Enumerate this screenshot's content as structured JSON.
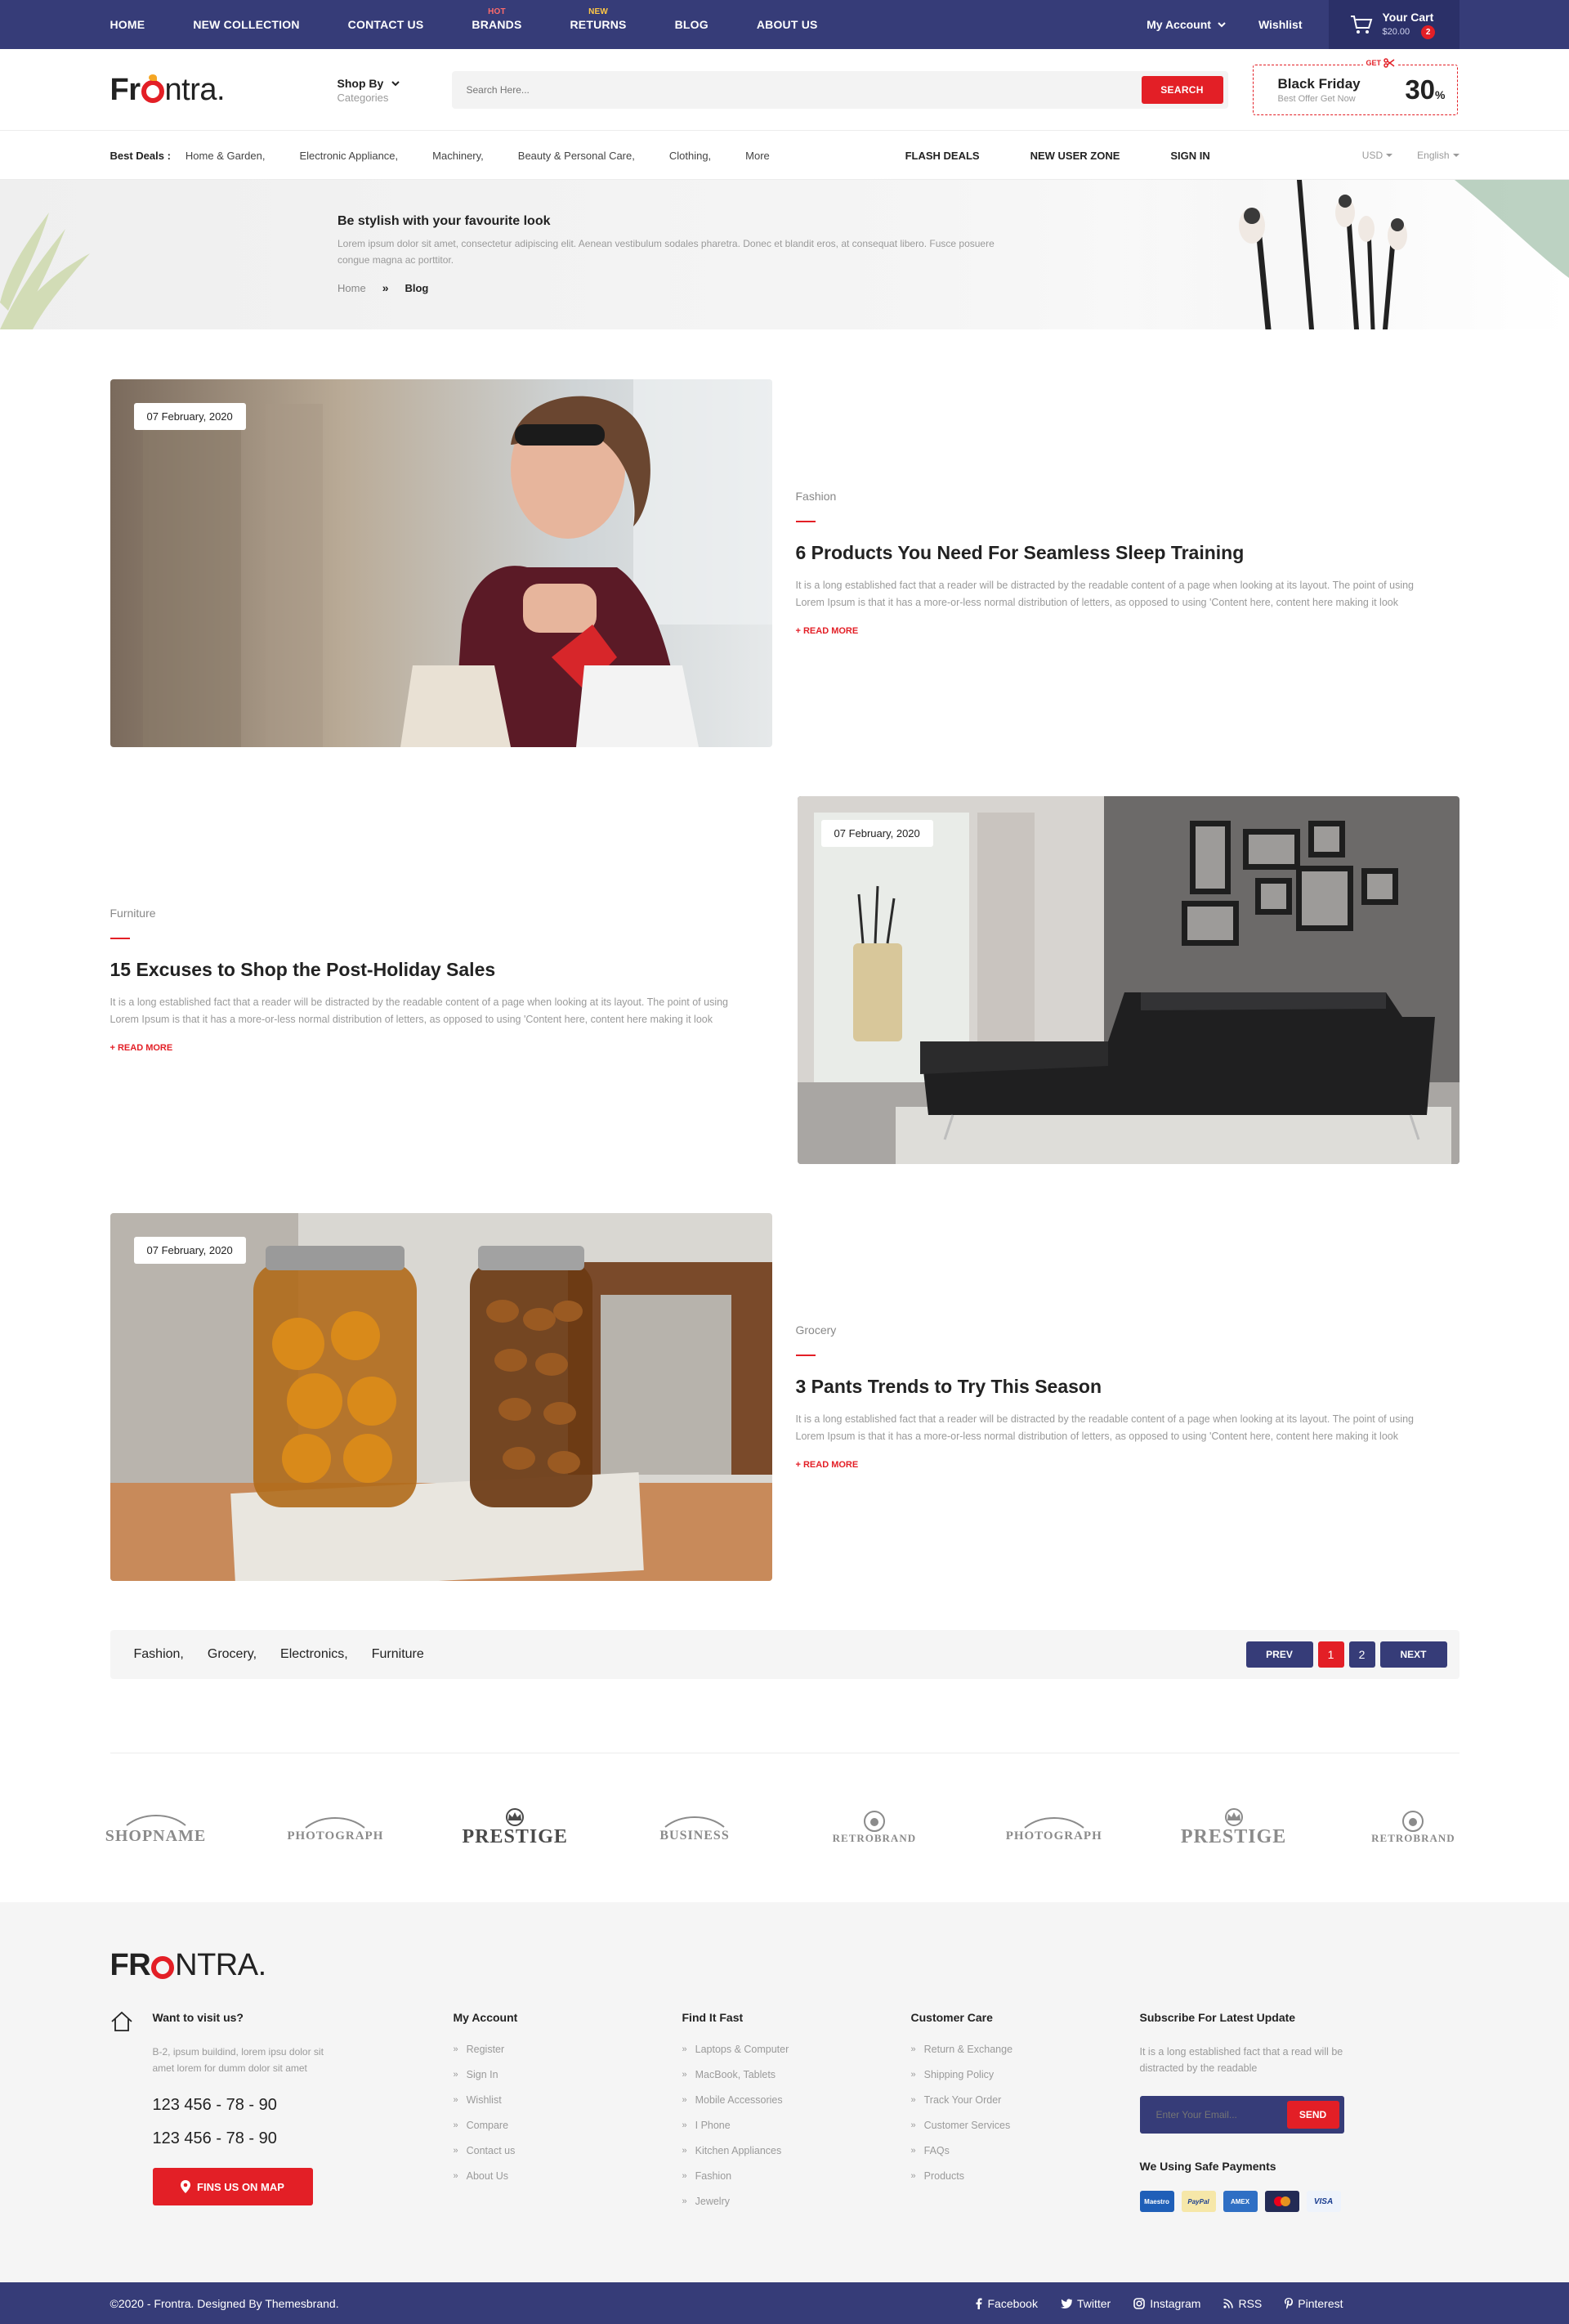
{
  "topnav": {
    "items": [
      {
        "label": "HOME",
        "badge": ""
      },
      {
        "label": "NEW COLLECTION",
        "badge": ""
      },
      {
        "label": "CONTACT US",
        "badge": ""
      },
      {
        "label": "BRANDS",
        "badge": "HOT"
      },
      {
        "label": "RETURNS",
        "badge": "NEW"
      },
      {
        "label": "BLOG",
        "badge": ""
      },
      {
        "label": "ABOUT US",
        "badge": ""
      }
    ],
    "account": "My Account",
    "wishlist": "Wishlist",
    "cart": {
      "title": "Your Cart",
      "amount": "$20.00",
      "count": "2"
    }
  },
  "header": {
    "logo": {
      "pre": "Fr",
      "post": "ntra."
    },
    "shopby": {
      "title": "Shop By",
      "sub": "Categories"
    },
    "search": {
      "placeholder": "Search Here...",
      "button": "SEARCH"
    },
    "promo": {
      "get": "GET",
      "title": "Black Friday",
      "sub": "Best Offer Get Now",
      "value": "30",
      "unit": "%"
    }
  },
  "deals": {
    "label": "Best Deals :",
    "links": [
      "Home & Garden,",
      "Electronic Appliance,",
      "Machinery,",
      "Beauty & Personal Care,",
      "Clothing,",
      "More"
    ],
    "strong": [
      "FLASH DEALS",
      "NEW USER ZONE",
      "SIGN IN"
    ],
    "currency": "USD",
    "language": "English"
  },
  "hero": {
    "title": "Be stylish with your favourite look",
    "text": "Lorem ipsum dolor sit amet, consectetur adipiscing elit. Aenean vestibulum sodales pharetra. Donec et blandit eros, at consequat libero. Fusce posuere congue magna ac porttitor.",
    "breadcrumb": {
      "home": "Home",
      "sep": "»",
      "current": "Blog"
    }
  },
  "posts": [
    {
      "date": "07 February, 2020",
      "category": "Fashion",
      "title": "6 Products You Need For Seamless Sleep Training",
      "text": "It is a long established fact that a reader will be distracted by the readable content of a page when looking at its layout. The point of using Lorem Ipsum is that it has a more-or-less normal distribution of letters, as opposed to using 'Content here, content here making it look",
      "more": "+ READ MORE"
    },
    {
      "date": "07 February, 2020",
      "category": "Furniture",
      "title": "15 Excuses to Shop the Post-Holiday Sales",
      "text": "It is a long established fact that a reader will be distracted by the readable content of a page when looking at its layout. The point of using Lorem Ipsum is that it has a more-or-less normal distribution of letters, as opposed to using 'Content here, content here making it look",
      "more": "+ READ MORE"
    },
    {
      "date": "07 February, 2020",
      "category": "Grocery",
      "title": "3 Pants Trends to Try This Season",
      "text": "It is a long established fact that a reader will be distracted by the readable content of a page when looking at its layout. The point of using Lorem Ipsum is that it has a more-or-less normal distribution of letters, as opposed to using 'Content here, content here making it look",
      "more": "+ READ MORE"
    }
  ],
  "tags": [
    "Fashion,",
    "Grocery,",
    "Electronics,",
    "Furniture"
  ],
  "pager": {
    "prev": "PREV",
    "pages": [
      "1",
      "2"
    ],
    "next": "NEXT"
  },
  "brands": [
    "SHOPNAME",
    "PHOTOGRAPH",
    "PRESTIGE",
    "BUSINESS",
    "RETROBRAND",
    "PHOTOGRAPH",
    "PRESTIGE",
    "RETROBRAND"
  ],
  "footer": {
    "logo": {
      "pre": "FR",
      "post": "NTRA."
    },
    "visit": {
      "title": "Want to visit us?",
      "address": "B-2, ipsum buildind, lorem ipsu dolor sit amet lorem for dumm dolor sit amet",
      "phone1": "123 456 - 78 - 90",
      "phone2": "123 456 - 78 - 90",
      "map_button": "FINS US ON MAP"
    },
    "account": {
      "title": "My Account",
      "links": [
        "Register",
        "Sign In",
        "Wishlist",
        "Compare",
        "Contact us",
        "About Us"
      ]
    },
    "find": {
      "title": "Find It Fast",
      "links": [
        "Laptops & Computer",
        "MacBook, Tablets",
        "Mobile Accessories",
        "I Phone",
        "Kitchen Appliances",
        "Fashion",
        "Jewelry"
      ]
    },
    "care": {
      "title": "Customer Care",
      "links": [
        "Return & Exchange",
        "Shipping Policy",
        "Track Your Order",
        "Customer Services",
        "FAQs",
        "Products"
      ]
    },
    "subscribe": {
      "title": "Subscribe For Latest Update",
      "text": "It is a long established fact that a read will be distracted by the readable",
      "placeholder": "Enter Your Email...",
      "button": "SEND",
      "payments_title": "We Using Safe Payments",
      "cards": [
        "Maestro",
        "PayPal",
        "AMEX",
        "",
        "VISA"
      ]
    },
    "copyright": "©2020 - Frontra. Designed By Themesbrand.",
    "socials": [
      "Facebook",
      "Twitter",
      "Instagram",
      "RSS",
      "Pinterest"
    ]
  },
  "colors": {
    "primary": "#363c78",
    "accent": "#e31f26",
    "footer_bg": "#f5f5f5"
  }
}
